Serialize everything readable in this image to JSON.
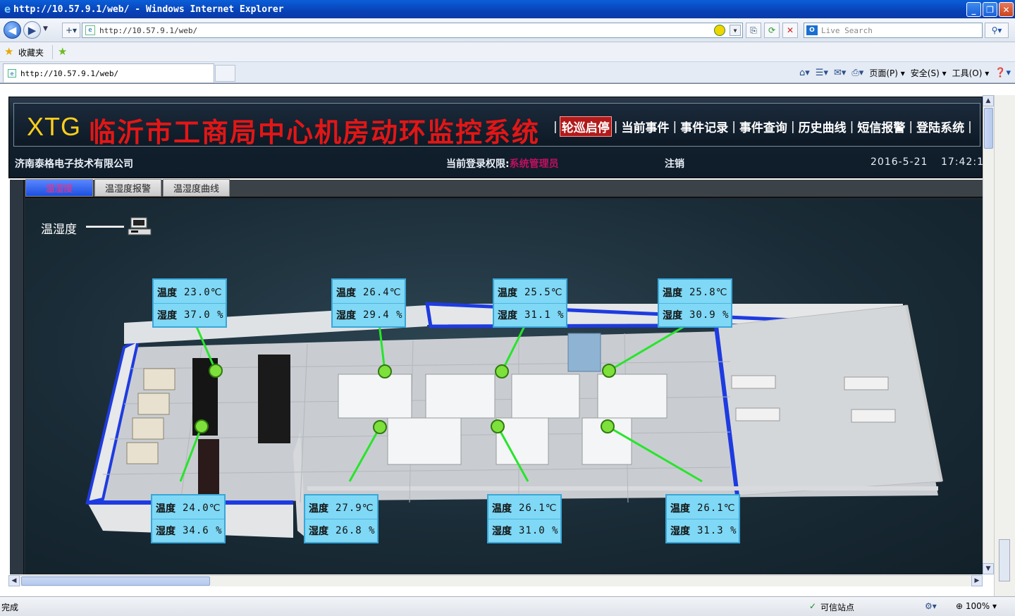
{
  "browser": {
    "window_title": "http://10.57.9.1/web/ - Windows Internet Explorer",
    "url": "http://10.57.9.1/web/",
    "search_placeholder": "Live Search",
    "favorites_label": "收藏夹",
    "tab_title": "http://10.57.9.1/web/",
    "cmd_page": "页面(P)",
    "cmd_safety": "安全(S)",
    "cmd_tools": "工具(O)",
    "status_done": "完成",
    "status_zone": "可信站点",
    "status_zoom": "100%"
  },
  "app": {
    "brand": "XTG",
    "title": "临沂市工商局中心机房动环监控系统",
    "nav": [
      "轮巡启停",
      "当前事件",
      "事件记录",
      "事件查询",
      "历史曲线",
      "短信报警",
      "登陆系统"
    ],
    "company": "济南泰格电子技术有限公司",
    "role_label": "当前登录权限:",
    "role_value": "系统管理员",
    "logout": "注销",
    "date": "2016-5-21",
    "time": "17:42:1"
  },
  "subtabs": [
    "温湿度",
    "温湿度报警",
    "温湿度曲线"
  ],
  "legend_label": "温湿度",
  "labels": {
    "temp": "温度",
    "humid": "湿度",
    "temp_unit": "℃",
    "humid_unit": "%"
  },
  "sensors": [
    {
      "temp": "23.0",
      "humid": "37.0"
    },
    {
      "temp": "26.4",
      "humid": "29.4"
    },
    {
      "temp": "25.5",
      "humid": "31.1"
    },
    {
      "temp": "25.8",
      "humid": "30.9"
    },
    {
      "temp": "24.0",
      "humid": "34.6"
    },
    {
      "temp": "27.9",
      "humid": "26.8"
    },
    {
      "temp": "26.1",
      "humid": "31.0"
    },
    {
      "temp": "26.1",
      "humid": "31.3"
    }
  ],
  "colors": {
    "title_red": "#e21616",
    "brand_yellow": "#ffcf1a",
    "sensor_bg": "#7fd8f5",
    "wall_blue": "#1e3be0",
    "sensor_dot": "#7ee03a"
  }
}
